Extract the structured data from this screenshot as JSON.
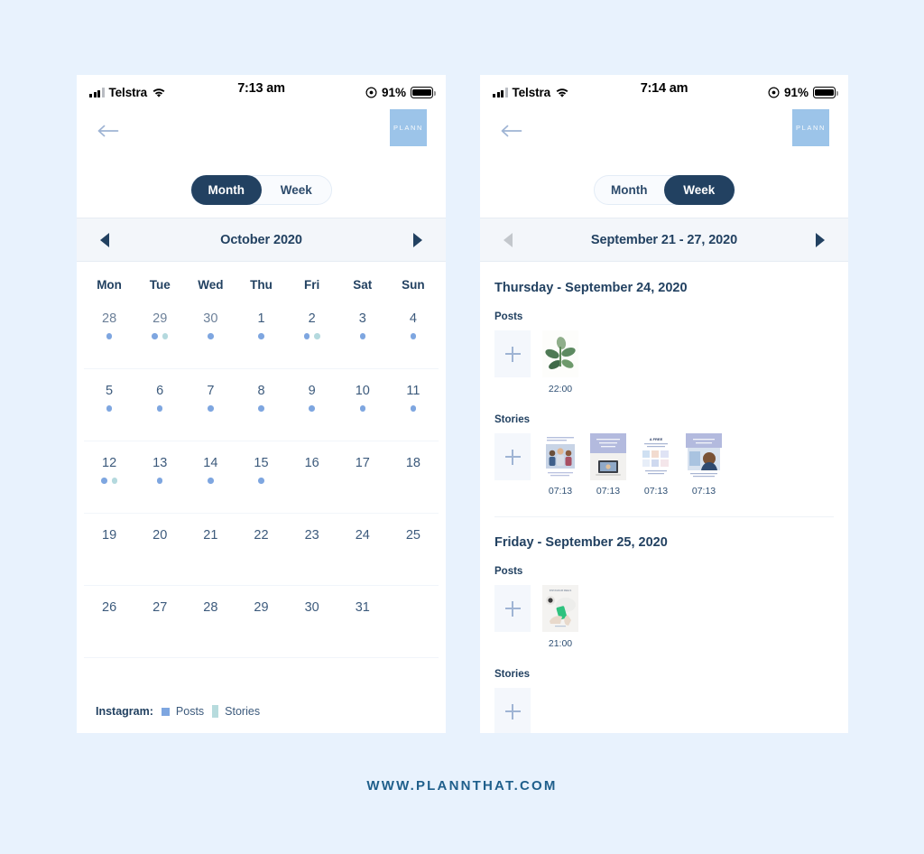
{
  "footer": {
    "url": "WWW.PLANNTHAT.COM"
  },
  "colors": {
    "page_background": "#e8f2fd",
    "brand_navy": "#224161",
    "post_dot": "#7ea6e0",
    "story_dot": "#b4d9de",
    "logo_badge": "#9cc4e9",
    "header_bar": "#f3f6fa"
  },
  "phone_left": {
    "status_bar": {
      "carrier": "Telstra",
      "time": "7:13 am",
      "battery_percent": "91%",
      "signal_icon": "signal-bars-icon",
      "wifi_icon": "wifi-icon",
      "location_icon": "location-services-icon",
      "battery_icon": "battery-icon"
    },
    "nav": {
      "back_icon": "back-arrow-icon",
      "logo_text": "PLANN"
    },
    "toggle": {
      "options": [
        "Month",
        "Week"
      ],
      "selected": "Month"
    },
    "calendar_header": {
      "title": "October 2020",
      "prev_icon": "chevron-left-icon",
      "next_icon": "chevron-right-icon",
      "prev_disabled": false,
      "next_disabled": false
    },
    "day_names": [
      "Mon",
      "Tue",
      "Wed",
      "Thu",
      "Fri",
      "Sat",
      "Sun"
    ],
    "weeks": [
      [
        {
          "num": "28",
          "muted": true,
          "dots": [
            "post"
          ]
        },
        {
          "num": "29",
          "muted": true,
          "dots": [
            "post",
            "story"
          ]
        },
        {
          "num": "30",
          "muted": true,
          "dots": [
            "post"
          ]
        },
        {
          "num": "1",
          "muted": false,
          "dots": [
            "post"
          ]
        },
        {
          "num": "2",
          "muted": false,
          "dots": [
            "post",
            "story"
          ]
        },
        {
          "num": "3",
          "muted": false,
          "dots": [
            "post"
          ]
        },
        {
          "num": "4",
          "muted": false,
          "dots": [
            "post"
          ]
        }
      ],
      [
        {
          "num": "5",
          "muted": false,
          "dots": [
            "post"
          ]
        },
        {
          "num": "6",
          "muted": false,
          "dots": [
            "post"
          ]
        },
        {
          "num": "7",
          "muted": false,
          "dots": [
            "post"
          ]
        },
        {
          "num": "8",
          "muted": false,
          "dots": [
            "post"
          ]
        },
        {
          "num": "9",
          "muted": false,
          "dots": [
            "post"
          ]
        },
        {
          "num": "10",
          "muted": false,
          "dots": [
            "post"
          ]
        },
        {
          "num": "11",
          "muted": false,
          "dots": [
            "post"
          ]
        }
      ],
      [
        {
          "num": "12",
          "muted": false,
          "dots": [
            "post",
            "story"
          ]
        },
        {
          "num": "13",
          "muted": false,
          "dots": [
            "post"
          ]
        },
        {
          "num": "14",
          "muted": false,
          "dots": [
            "post"
          ]
        },
        {
          "num": "15",
          "muted": false,
          "dots": [
            "post"
          ]
        },
        {
          "num": "16",
          "muted": false,
          "dots": []
        },
        {
          "num": "17",
          "muted": false,
          "dots": []
        },
        {
          "num": "18",
          "muted": false,
          "dots": []
        }
      ],
      [
        {
          "num": "19",
          "muted": false,
          "dots": []
        },
        {
          "num": "20",
          "muted": false,
          "dots": []
        },
        {
          "num": "21",
          "muted": false,
          "dots": []
        },
        {
          "num": "22",
          "muted": false,
          "dots": []
        },
        {
          "num": "23",
          "muted": false,
          "dots": []
        },
        {
          "num": "24",
          "muted": false,
          "dots": []
        },
        {
          "num": "25",
          "muted": false,
          "dots": []
        }
      ],
      [
        {
          "num": "26",
          "muted": false,
          "dots": []
        },
        {
          "num": "27",
          "muted": false,
          "dots": []
        },
        {
          "num": "28",
          "muted": false,
          "dots": []
        },
        {
          "num": "29",
          "muted": false,
          "dots": []
        },
        {
          "num": "30",
          "muted": false,
          "dots": []
        },
        {
          "num": "31",
          "muted": false,
          "dots": []
        },
        {
          "num": "",
          "muted": false,
          "dots": []
        }
      ]
    ],
    "legend": {
      "label": "Instagram:",
      "items": [
        {
          "name": "Posts",
          "swatch": "post"
        },
        {
          "name": "Stories",
          "swatch": "story"
        }
      ]
    }
  },
  "phone_right": {
    "status_bar": {
      "carrier": "Telstra",
      "time": "7:14 am",
      "battery_percent": "91%",
      "signal_icon": "signal-bars-icon",
      "wifi_icon": "wifi-icon",
      "location_icon": "location-services-icon",
      "battery_icon": "battery-icon"
    },
    "nav": {
      "back_icon": "back-arrow-icon",
      "logo_text": "PLANN"
    },
    "toggle": {
      "options": [
        "Month",
        "Week"
      ],
      "selected": "Week"
    },
    "calendar_header": {
      "title": "September 21 - 27, 2020",
      "prev_icon": "chevron-left-icon",
      "next_icon": "chevron-right-icon",
      "prev_disabled": true,
      "next_disabled": false
    },
    "days": [
      {
        "title": "Thursday - September 24, 2020",
        "posts_label": "Posts",
        "stories_label": "Stories",
        "posts": [
          {
            "time": "22:00",
            "image": "plant-photo"
          }
        ],
        "stories": [
          {
            "time": "07:13",
            "image": "group-people-photo"
          },
          {
            "time": "07:13",
            "image": "laptop-photo"
          },
          {
            "time": "07:13",
            "image": "free-guide-graphic"
          },
          {
            "time": "07:13",
            "image": "portrait-photo"
          }
        ]
      },
      {
        "title": "Friday - September 25, 2020",
        "posts_label": "Posts",
        "stories_label": "Stories",
        "posts": [
          {
            "time": "21:00",
            "image": "phone-hands-photo"
          }
        ],
        "stories": []
      }
    ]
  }
}
